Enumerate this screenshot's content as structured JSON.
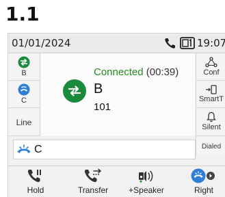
{
  "header": {
    "version": "1.1"
  },
  "statusbar": {
    "date": "01/01/2024",
    "time": "19:07"
  },
  "left_keys": [
    {
      "label": "B",
      "icon": "transfer-circle-icon",
      "color": "#1a8a3c"
    },
    {
      "label": "C",
      "icon": "on-hold-circle-icon",
      "color": "#2f7fd6"
    },
    {
      "label": "Line"
    }
  ],
  "right_keys": [
    {
      "label": "Conf",
      "icon": "conference-icon"
    },
    {
      "label": "SmartT",
      "icon": "smart-transfer-icon"
    },
    {
      "label": "Silent",
      "icon": "bell-icon"
    },
    {
      "label": "Dialed"
    }
  ],
  "call": {
    "status": "Connected",
    "duration": "(00:39)",
    "name": "B",
    "number": "101",
    "status_color": "#228b22"
  },
  "line_row": {
    "name": "C",
    "icon": "held-call-icon"
  },
  "softkeys": [
    {
      "label": "Hold",
      "icon": "hold-icon"
    },
    {
      "label": "Transfer",
      "icon": "transfer-icon"
    },
    {
      "label": "+Speaker",
      "icon": "speaker-icon"
    },
    {
      "label": "Right",
      "icon": "right-icon"
    }
  ]
}
